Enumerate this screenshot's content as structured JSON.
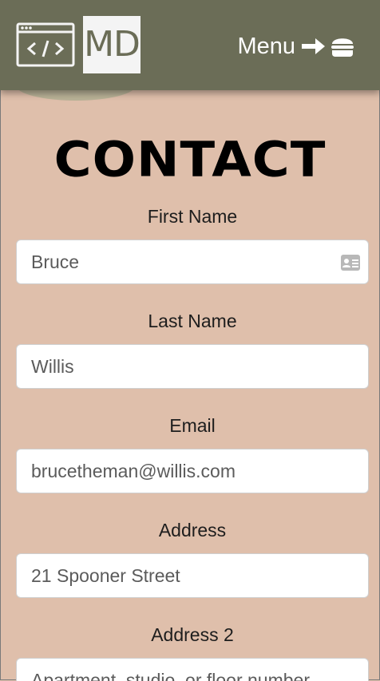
{
  "header": {
    "logo_code_icon": "code-window-icon",
    "logo_text": "MD",
    "menu_label": "Menu",
    "menu_arrow_icon": "arrow-right-icon",
    "menu_burger_icon": "hamburger-icon",
    "background_color": "#6b6d57"
  },
  "page": {
    "title": "CONTACT",
    "background_color": "#dfbfab"
  },
  "form": {
    "fields": [
      {
        "label": "First Name",
        "value": "Bruce",
        "icon": "contact-card-icon"
      },
      {
        "label": "Last Name",
        "value": "Willis"
      },
      {
        "label": "Email",
        "value": "brucetheman@willis.com"
      },
      {
        "label": "Address",
        "value": "21 Spooner Street"
      },
      {
        "label": "Address 2",
        "value": "Apartment, studio, or floor number"
      }
    ]
  }
}
